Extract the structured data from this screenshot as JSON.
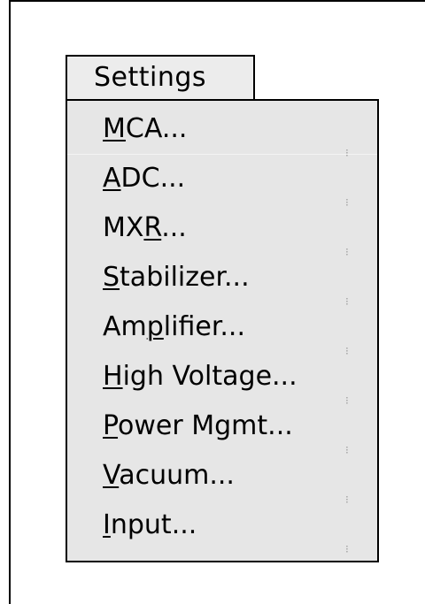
{
  "menu": {
    "title": "Settings",
    "items": [
      {
        "before": "",
        "mnemonic": "M",
        "after": "CA..."
      },
      {
        "before": "",
        "mnemonic": "A",
        "after": "DC..."
      },
      {
        "before": "MX",
        "mnemonic": "R",
        "after": "..."
      },
      {
        "before": "",
        "mnemonic": "S",
        "after": "tabilizer..."
      },
      {
        "before": "Am",
        "mnemonic": "p",
        "after": "lifier..."
      },
      {
        "before": "",
        "mnemonic": "H",
        "after": "igh Voltage..."
      },
      {
        "before": "",
        "mnemonic": "P",
        "after": "ower Mgmt..."
      },
      {
        "before": "",
        "mnemonic": "V",
        "after": "acuum..."
      },
      {
        "before": "",
        "mnemonic": "I",
        "after": "nput..."
      }
    ]
  },
  "colors": {
    "background": "#ffffff",
    "menu_bg": "#e6e6e6",
    "border": "#000000"
  }
}
